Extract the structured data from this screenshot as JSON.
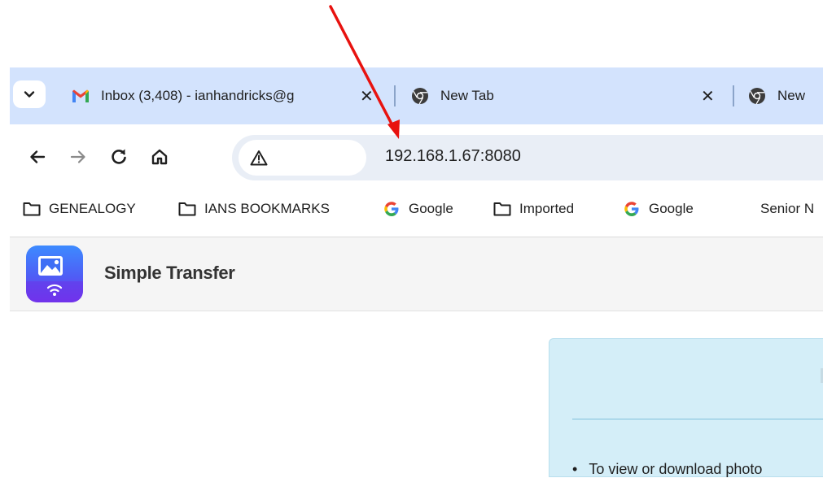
{
  "browser": {
    "tabs": [
      {
        "title": "Inbox (3,408) - ianhandricks@g",
        "icon": "gmail-icon",
        "close": "✕"
      },
      {
        "title": "New Tab",
        "icon": "chrome-icon",
        "close": "✕"
      },
      {
        "title": "New",
        "icon": "chrome-icon"
      }
    ],
    "url": "192.168.1.67:8080",
    "security_icon": "warning-triangle-icon",
    "bookmarks": [
      {
        "label": "GENEALOGY",
        "icon": "folder-icon"
      },
      {
        "label": "IANS BOOKMARKS",
        "icon": "folder-icon"
      },
      {
        "label": "Google",
        "icon": "google-icon"
      },
      {
        "label": "Imported",
        "icon": "folder-icon"
      },
      {
        "label": "Google",
        "icon": "google-icon"
      },
      {
        "label": "Senior N",
        "icon": "none"
      }
    ]
  },
  "app": {
    "title": "Simple Transfer",
    "icon": "simple-transfer-app-icon"
  },
  "panel": {
    "bullet": "To view or download photo"
  },
  "colors": {
    "tab_strip": "#d3e3fd",
    "omnibox": "#e9eef6",
    "annotation_arrow": "#e8120f",
    "panel_bg": "#d4eef8",
    "app_header": "#f5f5f5"
  }
}
